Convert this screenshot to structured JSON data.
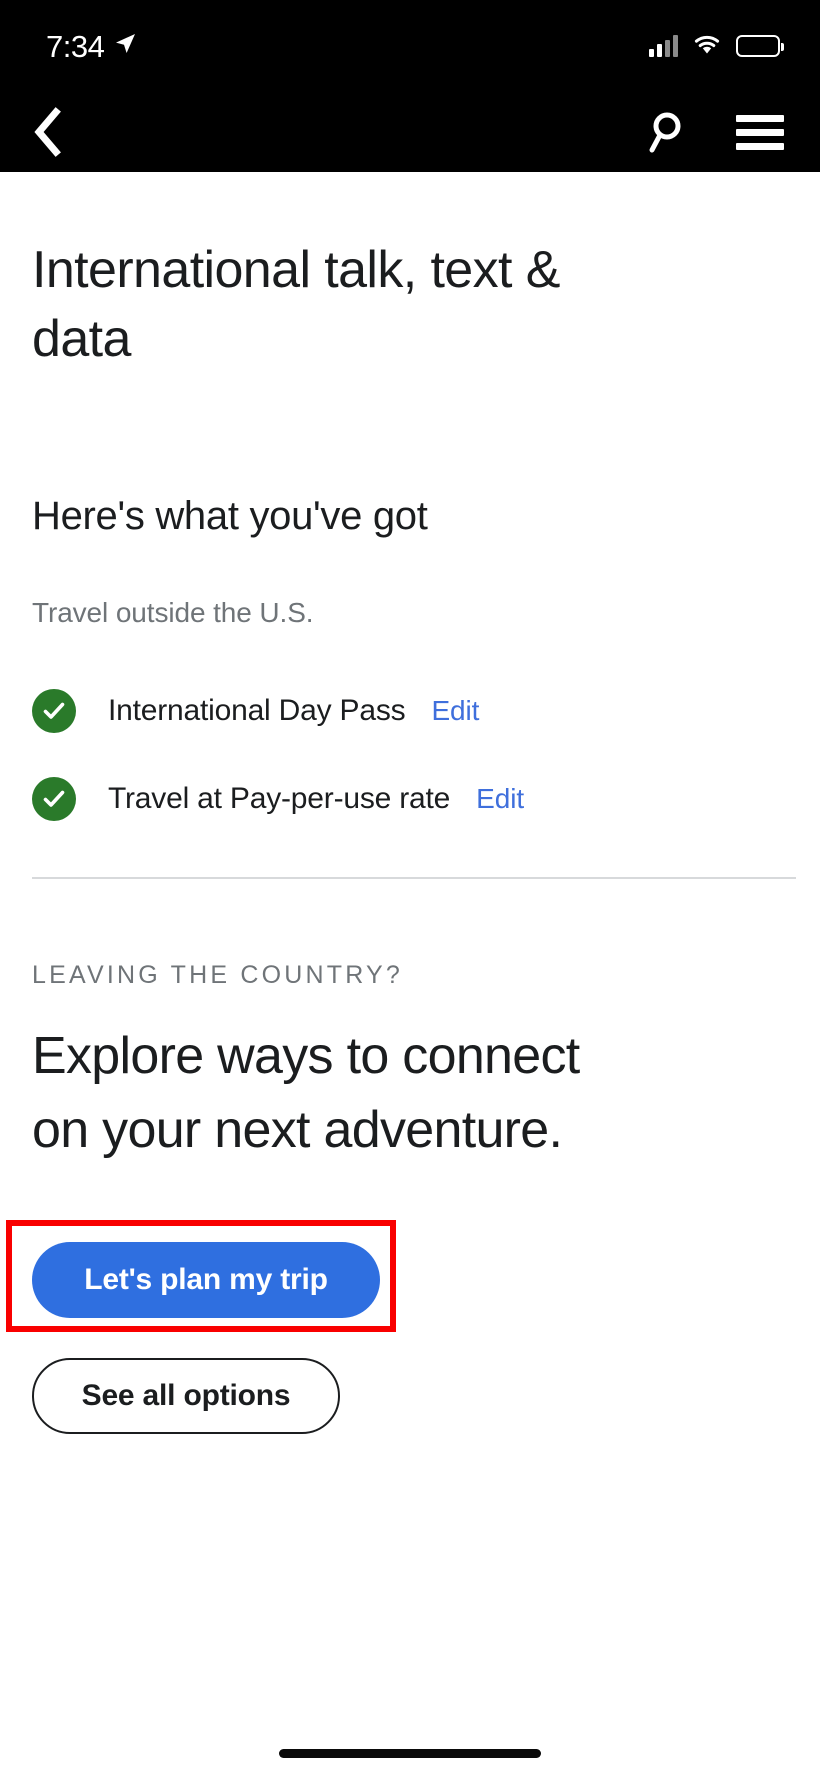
{
  "status_bar": {
    "time": "7:34",
    "location_icon": "location-arrow-icon",
    "signal_icon": "cellular-signal-icon",
    "wifi_icon": "wifi-icon",
    "battery_icon": "battery-icon"
  },
  "nav_bar": {
    "back_icon": "back-chevron-icon",
    "search_icon": "search-icon",
    "menu_icon": "hamburger-menu-icon"
  },
  "page": {
    "title": "International talk, text & data"
  },
  "summary": {
    "heading": "Here's what you've got",
    "subheading": "Travel outside the U.S.",
    "items": [
      {
        "label": "International Day Pass",
        "edit_label": "Edit",
        "status_icon": "check-circle-icon"
      },
      {
        "label": "Travel at Pay-per-use rate",
        "edit_label": "Edit",
        "status_icon": "check-circle-icon"
      }
    ]
  },
  "promo": {
    "eyebrow": "LEAVING THE COUNTRY?",
    "headline": "Explore ways to connect on your next adventure.",
    "primary_cta": "Let's plan my trip",
    "secondary_cta": "See all options"
  },
  "colors": {
    "accent_blue": "#2f6fe0",
    "link_blue": "#3f6fdc",
    "check_green": "#2a7a2a",
    "highlight_red": "#f90000",
    "text_dark": "#1b1d1f",
    "text_muted": "#6f7478"
  }
}
